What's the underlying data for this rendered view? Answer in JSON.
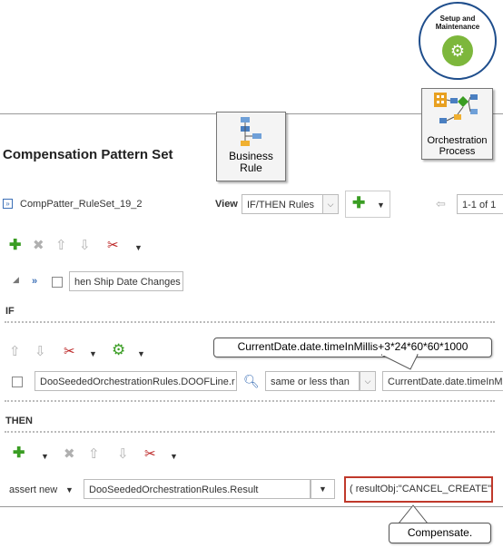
{
  "setup_badge": {
    "line1": "Setup and",
    "line2": "Maintenance"
  },
  "business_rule": {
    "line1": "Business",
    "line2": "Rule"
  },
  "orchestration": {
    "line1": "Orchestration",
    "line2": "Process"
  },
  "page_title": "Compensation Pattern Set",
  "ruleset_name": "CompPatter_RuleSet_19_2",
  "view_label": "View",
  "view_value": "IF/THEN Rules",
  "paging": "1-1 of 1",
  "rule_name": "hen Ship Date Changes",
  "if_label": "IF",
  "then_label": "THEN",
  "condition": {
    "left": "DooSeededOrchestrationRules.DOOFLine.r",
    "operator": "same or less than",
    "right": "CurrentDate.date.timeInM"
  },
  "tooltip": "CurrentDate.date.timeInMillis+3*24*60*60*1000",
  "action": {
    "verb": "assert new",
    "target": "DooSeededOrchestrationRules.Result",
    "value": "( resultObj:\"CANCEL_CREATE\" )"
  },
  "compensate_callout": "Compensate.",
  "colors": {
    "highlight": "#c0392b",
    "green": "#3a9d23",
    "badge": "#7db73c"
  }
}
